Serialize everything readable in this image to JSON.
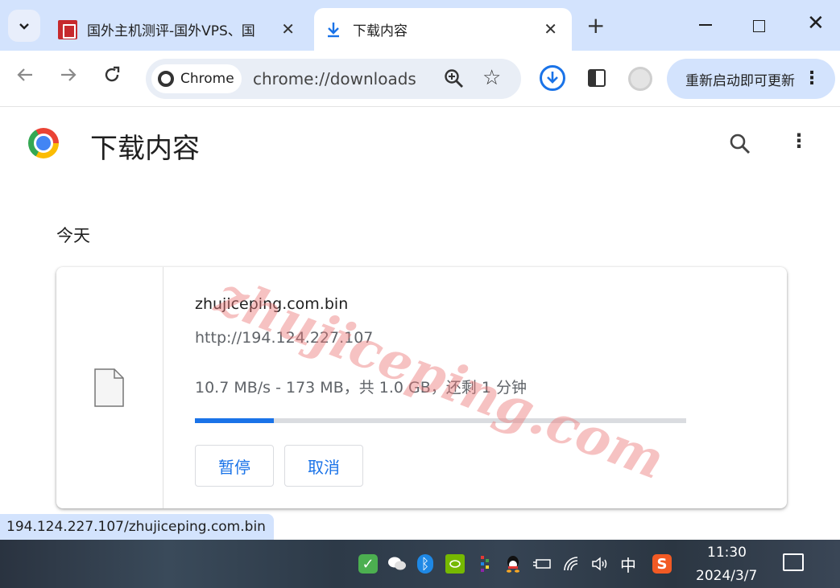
{
  "tabs": [
    {
      "title": "国外主机测评-国外VPS、国",
      "active": false
    },
    {
      "title": "下载内容",
      "active": true
    }
  ],
  "toolbar": {
    "chip_label": "Chrome",
    "url": "chrome://downloads",
    "update_label": "重新启动即可更新"
  },
  "page": {
    "title": "下载内容",
    "date_group": "今天"
  },
  "download": {
    "filename": "zhujiceping.com.bin",
    "source_url": "http://194.124.227.107",
    "status": "10.7 MB/s - 173 MB，共 1.0 GB，还剩 1 分钟",
    "progress": 0.16,
    "pause_label": "暂停",
    "cancel_label": "取消"
  },
  "watermark": "zhujiceping.com",
  "status_url": "194.124.227.107/zhujiceping.com.bin",
  "taskbar": {
    "ime": "中",
    "time": "11:30",
    "date": "2024/3/7"
  },
  "colors": {
    "accent": "#1a73e8",
    "tabstrip": "#d3e3fd",
    "omnibox": "#e9eef6"
  }
}
